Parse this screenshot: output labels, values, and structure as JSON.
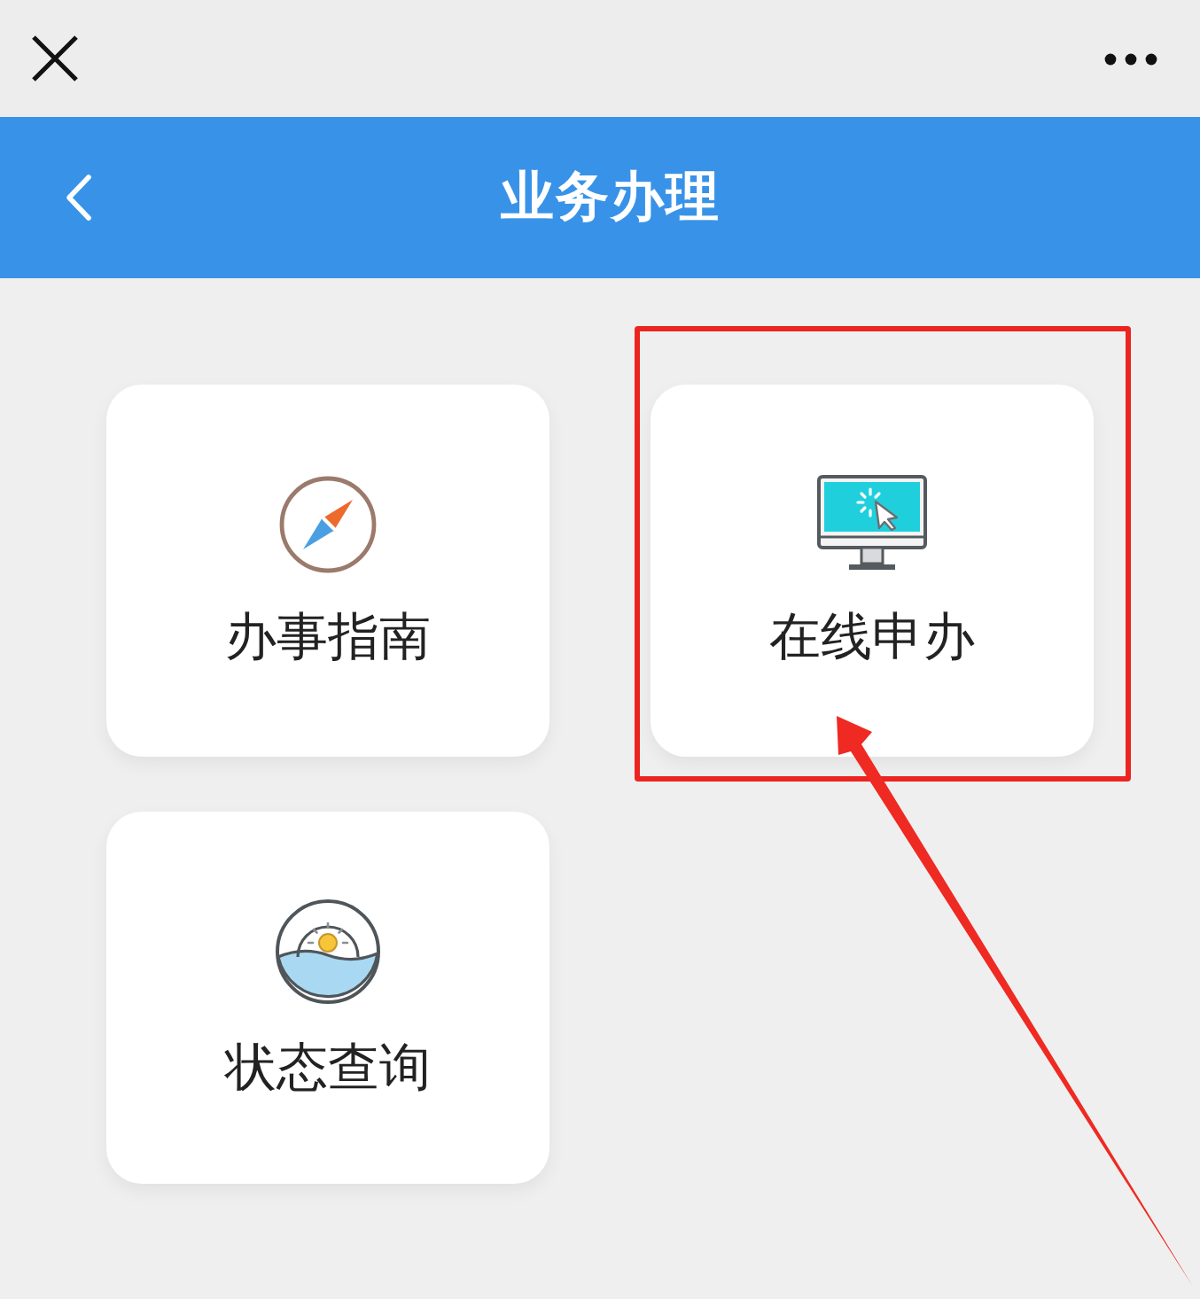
{
  "header": {
    "title": "业务办理"
  },
  "cards": [
    {
      "label": "办事指南",
      "highlighted": false
    },
    {
      "label": "在线申办",
      "highlighted": true
    },
    {
      "label": "状态查询",
      "highlighted": false
    }
  ]
}
